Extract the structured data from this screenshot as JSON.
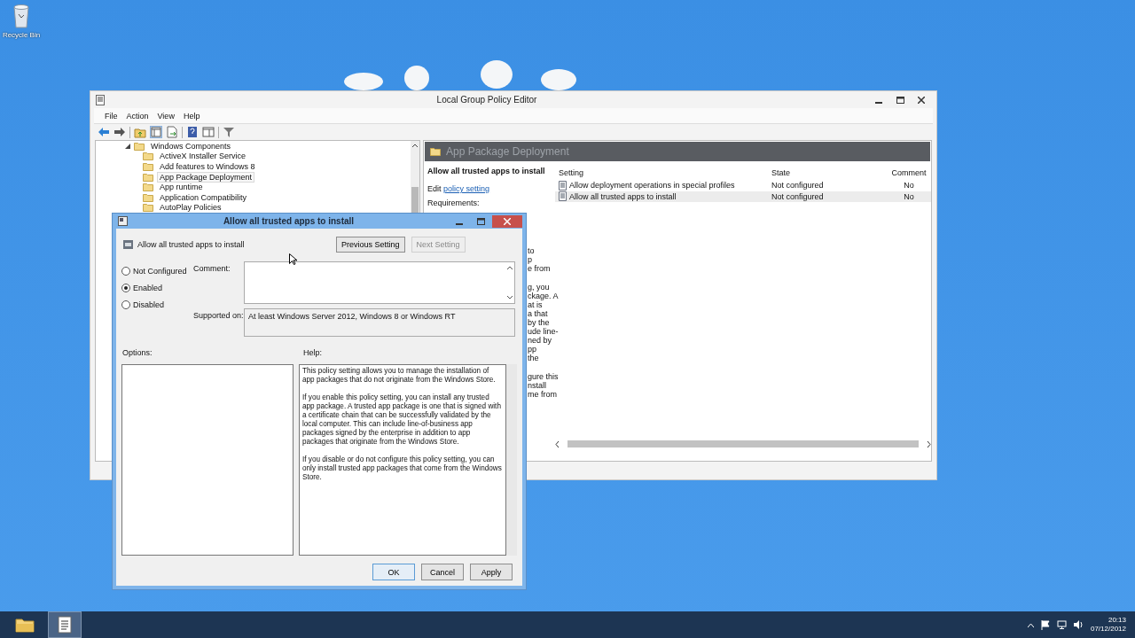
{
  "desktop": {
    "icons": [
      {
        "label": "Recycle Bin"
      }
    ]
  },
  "main_window": {
    "title": "Local Group Policy Editor",
    "menu": [
      "File",
      "Action",
      "View",
      "Help"
    ],
    "tree": [
      {
        "label": "Windows Components",
        "expanded": true,
        "selected": false,
        "children": [
          {
            "label": "ActiveX Installer Service",
            "selected": false
          },
          {
            "label": "Add features to Windows 8",
            "selected": false
          },
          {
            "label": "App Package Deployment",
            "selected": true
          },
          {
            "label": "App runtime",
            "selected": false
          },
          {
            "label": "Application Compatibility",
            "selected": false
          },
          {
            "label": "AutoPlay Policies",
            "selected": false
          }
        ]
      }
    ],
    "header": "App Package Deployment",
    "description": {
      "title": "Allow all trusted apps to install",
      "edit_prefix": "Edit",
      "edit_link": "policy setting",
      "requirements_label": "Requirements:",
      "partial_paragraphs": [
        [
          "to",
          "p",
          "e from"
        ],
        [
          "g, you",
          "ckage. A",
          "at is",
          "a that",
          "by the",
          "ude line-",
          "ned by",
          "pp",
          "the"
        ],
        [
          "gure this",
          "nstall",
          "me from"
        ]
      ]
    },
    "table": {
      "columns": [
        "Setting",
        "State",
        "Comment"
      ],
      "rows": [
        {
          "setting": "Allow deployment operations in special profiles",
          "state": "Not configured",
          "comment": "No",
          "selected": false
        },
        {
          "setting": "Allow all trusted apps to install",
          "state": "Not configured",
          "comment": "No",
          "selected": true
        }
      ]
    }
  },
  "dialog": {
    "title": "Allow all trusted apps to install",
    "policy_name": "Allow all trusted apps to install",
    "nav_buttons": [
      {
        "label": "Previous Setting",
        "disabled": false
      },
      {
        "label": "Next Setting",
        "disabled": true
      }
    ],
    "radios": [
      {
        "label": "Not Configured",
        "selected": false
      },
      {
        "label": "Enabled",
        "selected": true
      },
      {
        "label": "Disabled",
        "selected": false
      }
    ],
    "comment_label": "Comment:",
    "supported_label": "Supported on:",
    "supported_value": "At least Windows Server 2012, Windows 8 or Windows RT",
    "options_label": "Options:",
    "help_label": "Help:",
    "help_paragraphs": [
      "This policy setting allows you to manage the installation of app packages that do not originate from the Windows Store.",
      "If you enable this policy setting, you can install any trusted app package. A trusted app package is one that is signed with a certificate chain that can be successfully validated by the local computer. This can include line-of-business app packages signed by the enterprise in addition to app packages that originate from the Windows Store.",
      "If you disable or do not configure this policy setting, you can only install trusted app packages that come from the Windows Store."
    ],
    "buttons": [
      {
        "label": "OK",
        "default": true
      },
      {
        "label": "Cancel",
        "default": false
      },
      {
        "label": "Apply",
        "default": false
      }
    ]
  },
  "taskbar": {
    "apps": [
      {
        "kind": "explorer",
        "active": false
      },
      {
        "kind": "policy-editor",
        "active": true
      }
    ],
    "clock": {
      "time": "20:13",
      "date": "07/12/2012"
    }
  }
}
